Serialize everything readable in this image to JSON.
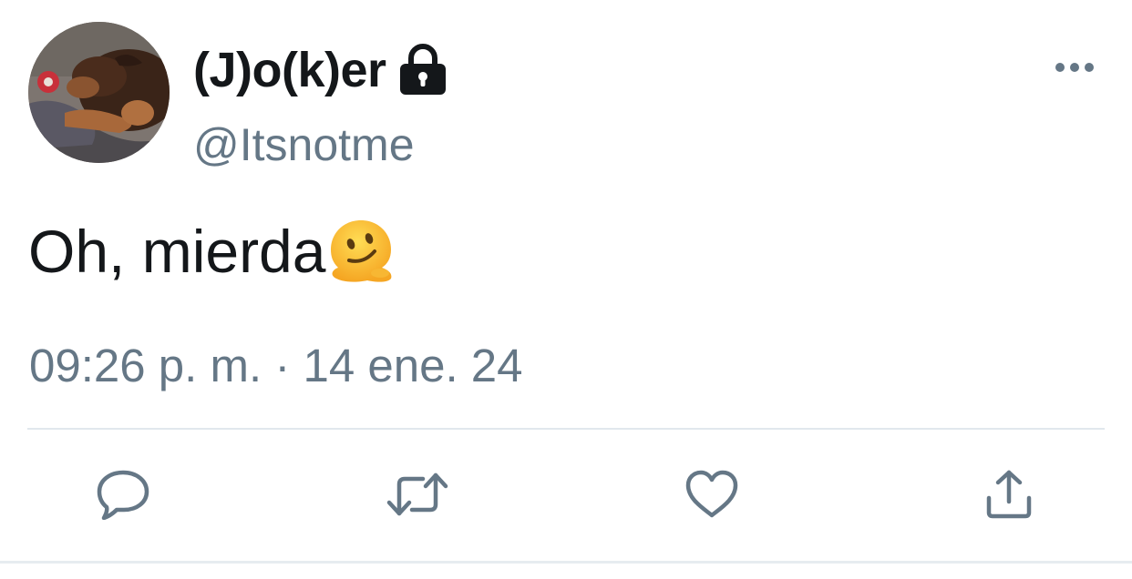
{
  "tweet": {
    "display_name": "(J)o(k)er",
    "handle": "@Itsnotme",
    "text": "Oh, mierda",
    "emoji": "melting-face",
    "timestamp": "09:26 p. m. · 14 ene. 24",
    "protected": true
  },
  "icons": {
    "lock": "lock-icon",
    "more": "more-icon",
    "reply": "reply-icon",
    "retweet": "retweet-icon",
    "like": "heart-icon",
    "share": "share-icon"
  },
  "colors": {
    "text_primary": "#14171a",
    "text_secondary": "#657786",
    "icon": "#657786",
    "divider": "#e1e8ed"
  }
}
